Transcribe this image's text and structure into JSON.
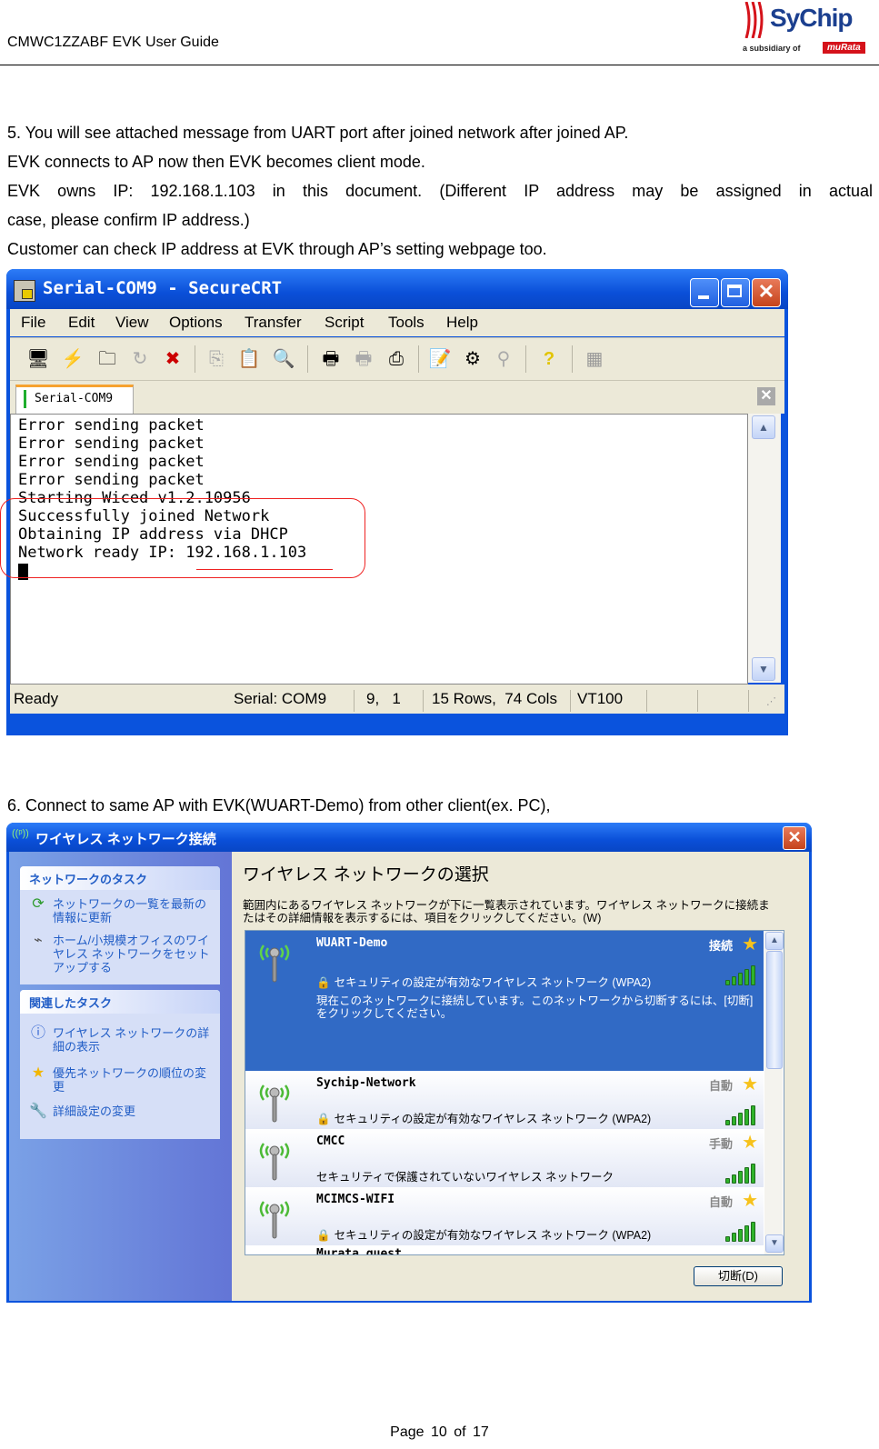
{
  "header": {
    "doc_title": "CMWC1ZZABF EVK User Guide",
    "logo": {
      "brand": "SyChip",
      "tagline": "a subsidiary of",
      "parent": "muRata"
    }
  },
  "step5": {
    "lines": [
      "5.   You will see attached message from UART port after joined network after joined AP.",
      "EVK connects to AP now then EVK becomes client mode.",
      "EVK owns IP: 192.168.1.103 in this document. (Different IP address may be assigned in actual",
      "case, please confirm IP address.)",
      "Customer can check IP address at EVK through AP’s setting webpage too."
    ]
  },
  "securecrt": {
    "title": "Serial-COM9 - SecureCRT",
    "menu": [
      "File",
      "Edit",
      "View",
      "Options",
      "Transfer",
      "Script",
      "Tools",
      "Help"
    ],
    "toolbar_icons": [
      "connect-icon",
      "quick-connect-icon",
      "connect-tab-icon",
      "reconnect-icon",
      "disconnect-icon",
      "copy-icon",
      "paste-icon",
      "find-icon",
      "print-screen-icon",
      "print-selection-icon",
      "printer-icon",
      "session-options-icon",
      "sftp-icon",
      "key-icon",
      "help-icon",
      "keymap-icon"
    ],
    "tab_label": "Serial-COM9",
    "terminal_lines": [
      "Error sending packet",
      "Error sending packet",
      "Error sending packet",
      "Error sending packet",
      "Starting Wiced v1.2.10956",
      "Successfully joined Network",
      "Obtaining IP address via DHCP",
      "Network ready IP: 192.168.1.103"
    ],
    "status": {
      "state": "Ready",
      "port": "Serial: COM9",
      "cursor": "9,   1",
      "size": "15 Rows,  74 Cols",
      "emulation": "VT100"
    },
    "highlight_color": "#e02222"
  },
  "step6": {
    "line": "6.   Connect to same AP with EVK(WUART-Demo) from other client(ex. PC),"
  },
  "wireless": {
    "title": "ワイヤレス ネットワーク接続",
    "tasks": {
      "network_tasks_header": "ネットワークのタスク",
      "network_tasks": [
        {
          "icon": "refresh-icon",
          "label": "ネットワークの一覧を最新の情報に更新"
        },
        {
          "icon": "router-icon",
          "label": "ホーム/小規模オフィスのワイヤレス ネットワークをセットアップする"
        }
      ],
      "related_tasks_header": "関連したタスク",
      "related_tasks": [
        {
          "icon": "info-icon",
          "label": "ワイヤレス ネットワークの詳細の表示"
        },
        {
          "icon": "star-icon",
          "label": "優先ネットワークの順位の変更"
        },
        {
          "icon": "settings-icon",
          "label": "詳細設定の変更"
        }
      ]
    },
    "heading": "ワイヤレス ネットワークの選択",
    "description": "範囲内にあるワイヤレス ネットワークが下に一覧表示されています。ワイヤレス ネットワークに接続またはその詳細情報を表示するには、項目をクリックしてください。(W)",
    "networks": [
      {
        "ssid": "WUART-Demo",
        "status": "接続",
        "security": "セキュリティの設定が有効なワイヤレス ネットワーク (WPA2)",
        "secured": true,
        "message": "現在このネットワークに接続しています。このネットワークから切断するには、[切断] をクリックしてください。",
        "signal_bars": 5,
        "selected": true
      },
      {
        "ssid": "Sychip-Network",
        "status": "自動",
        "security": "セキュリティの設定が有効なワイヤレス ネットワーク (WPA2)",
        "secured": true,
        "signal_bars": 5,
        "selected": false
      },
      {
        "ssid": "CMCC",
        "status": "手動",
        "security": "セキュリティで保護されていないワイヤレス ネットワーク",
        "secured": false,
        "signal_bars": 5,
        "selected": false
      },
      {
        "ssid": "MCIMCS-WIFI",
        "status": "自動",
        "security": "セキュリティの設定が有効なワイヤレス ネットワーク (WPA2)",
        "secured": true,
        "signal_bars": 5,
        "selected": false
      },
      {
        "ssid": "Murata_guest",
        "status": "",
        "security": "",
        "secured": false,
        "signal_bars": 0,
        "selected": false
      }
    ],
    "disconnect_button": "切断(D)",
    "selected_color": "#316ac5"
  },
  "footer": {
    "page": "Page  10  of  17"
  }
}
